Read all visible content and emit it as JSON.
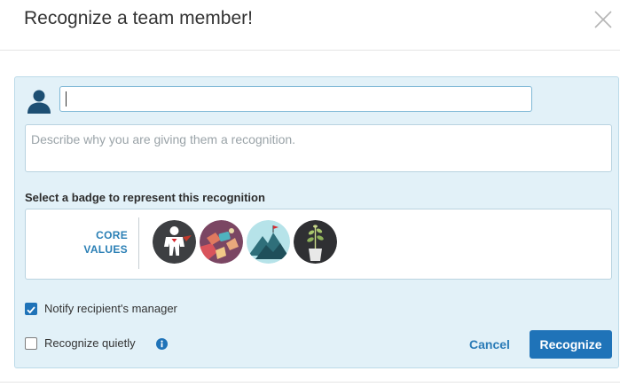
{
  "dialog": {
    "title": "Recognize a team member!"
  },
  "recipient": {
    "value": "",
    "placeholder": ""
  },
  "reason": {
    "placeholder": "Describe why you are giving them a recognition."
  },
  "badges": {
    "heading": "Select a badge to represent this recognition",
    "category_line1": "CORE",
    "category_line2": "VALUES",
    "items": [
      {
        "icon": "superhero-badge-icon"
      },
      {
        "icon": "teamwork-hands-badge-icon"
      },
      {
        "icon": "mountain-summit-badge-icon"
      },
      {
        "icon": "growth-plant-badge-icon"
      }
    ]
  },
  "options": {
    "notify_label": "Notify recipient's manager",
    "notify_checked": true,
    "quiet_label": "Recognize quietly",
    "quiet_checked": false
  },
  "actions": {
    "cancel_label": "Cancel",
    "recognize_label": "Recognize"
  },
  "colors": {
    "accent": "#1f73b8",
    "panel_bg": "#e2f1f8",
    "link": "#2b7cb7"
  }
}
